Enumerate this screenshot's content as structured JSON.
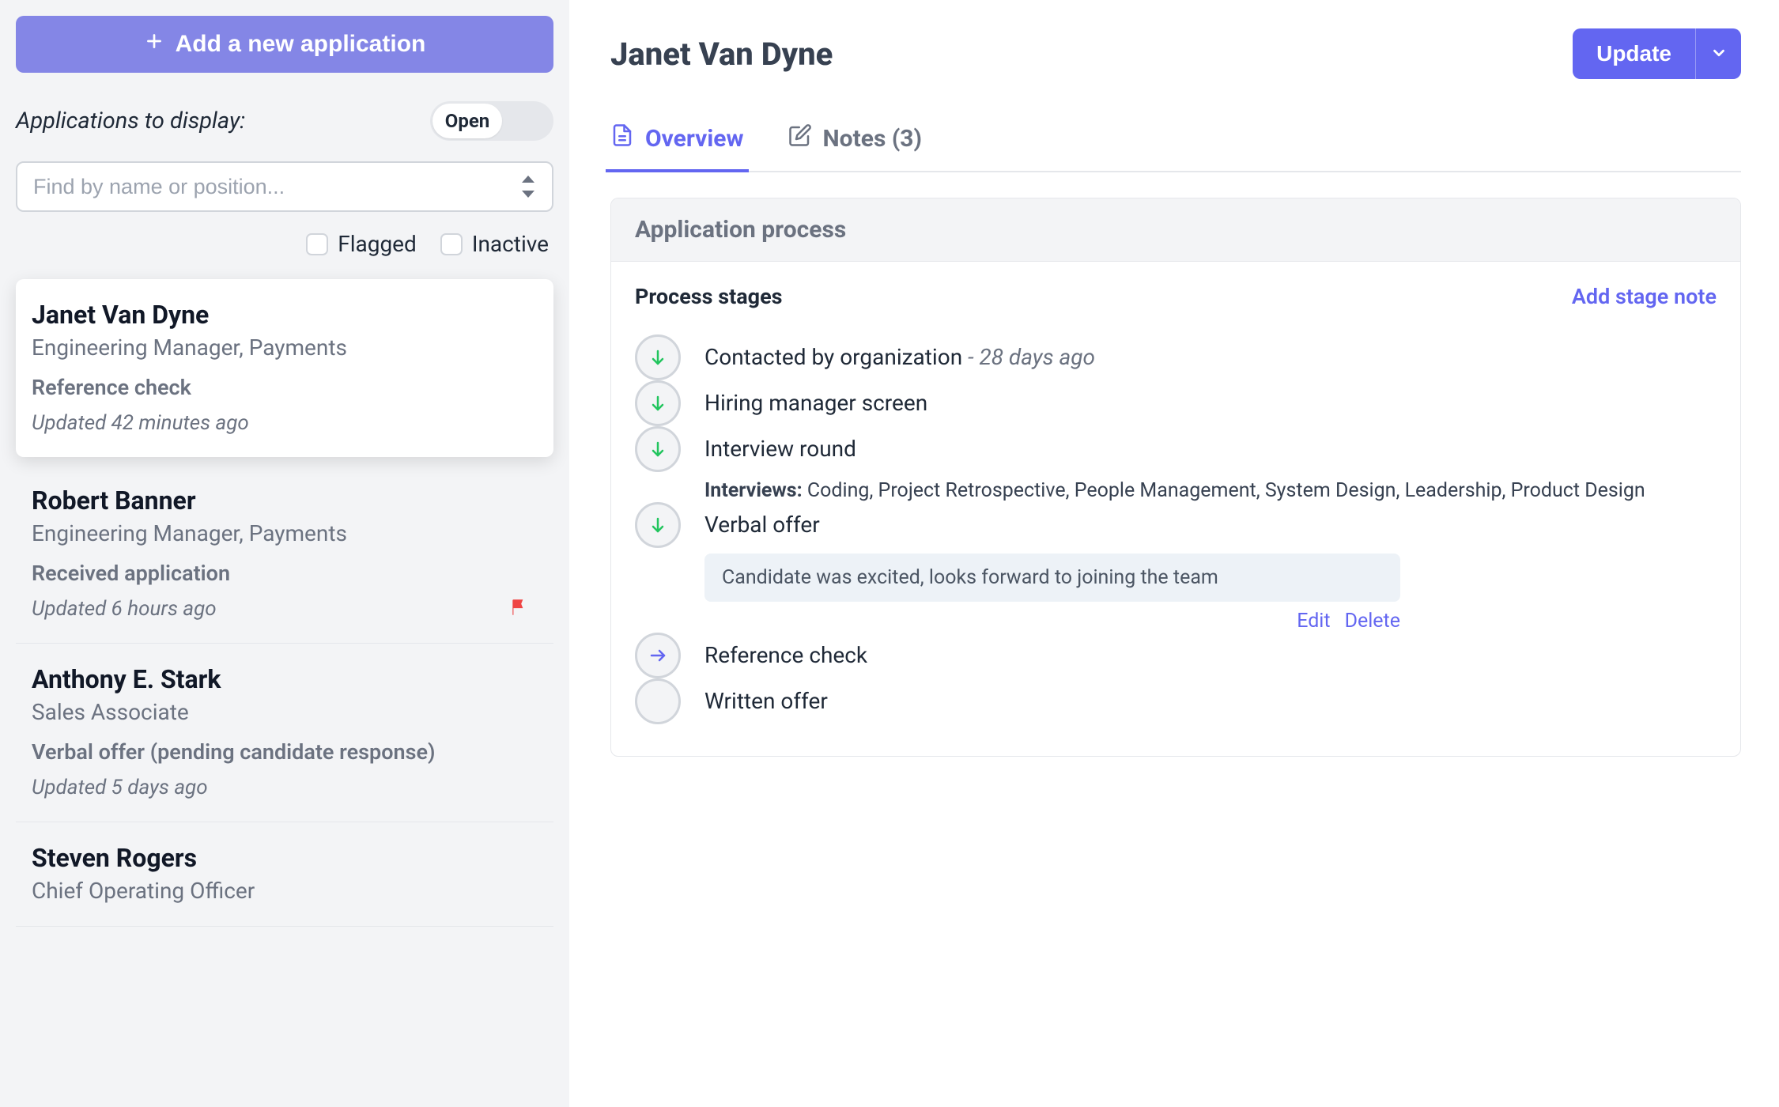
{
  "sidebar": {
    "add_label": "Add a new application",
    "filter_label": "Applications to display:",
    "toggle_value": "Open",
    "search_placeholder": "Find by name or position...",
    "flagged_label": "Flagged",
    "inactive_label": "Inactive"
  },
  "applications": [
    {
      "name": "Janet Van Dyne",
      "position": "Engineering Manager, Payments",
      "stage": "Reference check",
      "updated": "Updated 42 minutes ago",
      "flagged": false,
      "selected": true
    },
    {
      "name": "Robert Banner",
      "position": "Engineering Manager, Payments",
      "stage": "Received application",
      "updated": "Updated 6 hours ago",
      "flagged": true,
      "selected": false
    },
    {
      "name": "Anthony E. Stark",
      "position": "Sales Associate",
      "stage": "Verbal offer (pending candidate response)",
      "updated": "Updated 5 days ago",
      "flagged": false,
      "selected": false
    },
    {
      "name": "Steven Rogers",
      "position": "Chief Operating Officer",
      "stage": "",
      "updated": "",
      "flagged": false,
      "selected": false
    }
  ],
  "main": {
    "title": "Janet Van Dyne",
    "update_label": "Update",
    "tabs": {
      "overview": "Overview",
      "notes": "Notes (3)"
    },
    "panel_title": "Application process",
    "stages_title": "Process stages",
    "add_stage_note": "Add stage note",
    "note_edit": "Edit",
    "note_delete": "Delete",
    "interviews_prefix": "Interviews:"
  },
  "stages": [
    {
      "label": "Contacted by organization",
      "time": "- 28 days ago",
      "status": "done"
    },
    {
      "label": "Hiring manager screen",
      "time": "",
      "status": "done"
    },
    {
      "label": "Interview round",
      "time": "",
      "status": "done",
      "interviews": "Coding, Project Retrospective, People Management, System Design, Leadership, Product Design"
    },
    {
      "label": "Verbal offer",
      "time": "",
      "status": "done",
      "note": "Candidate was excited, looks forward to joining the team"
    },
    {
      "label": "Reference check",
      "time": "",
      "status": "current"
    },
    {
      "label": "Written offer",
      "time": "",
      "status": "pending"
    }
  ]
}
